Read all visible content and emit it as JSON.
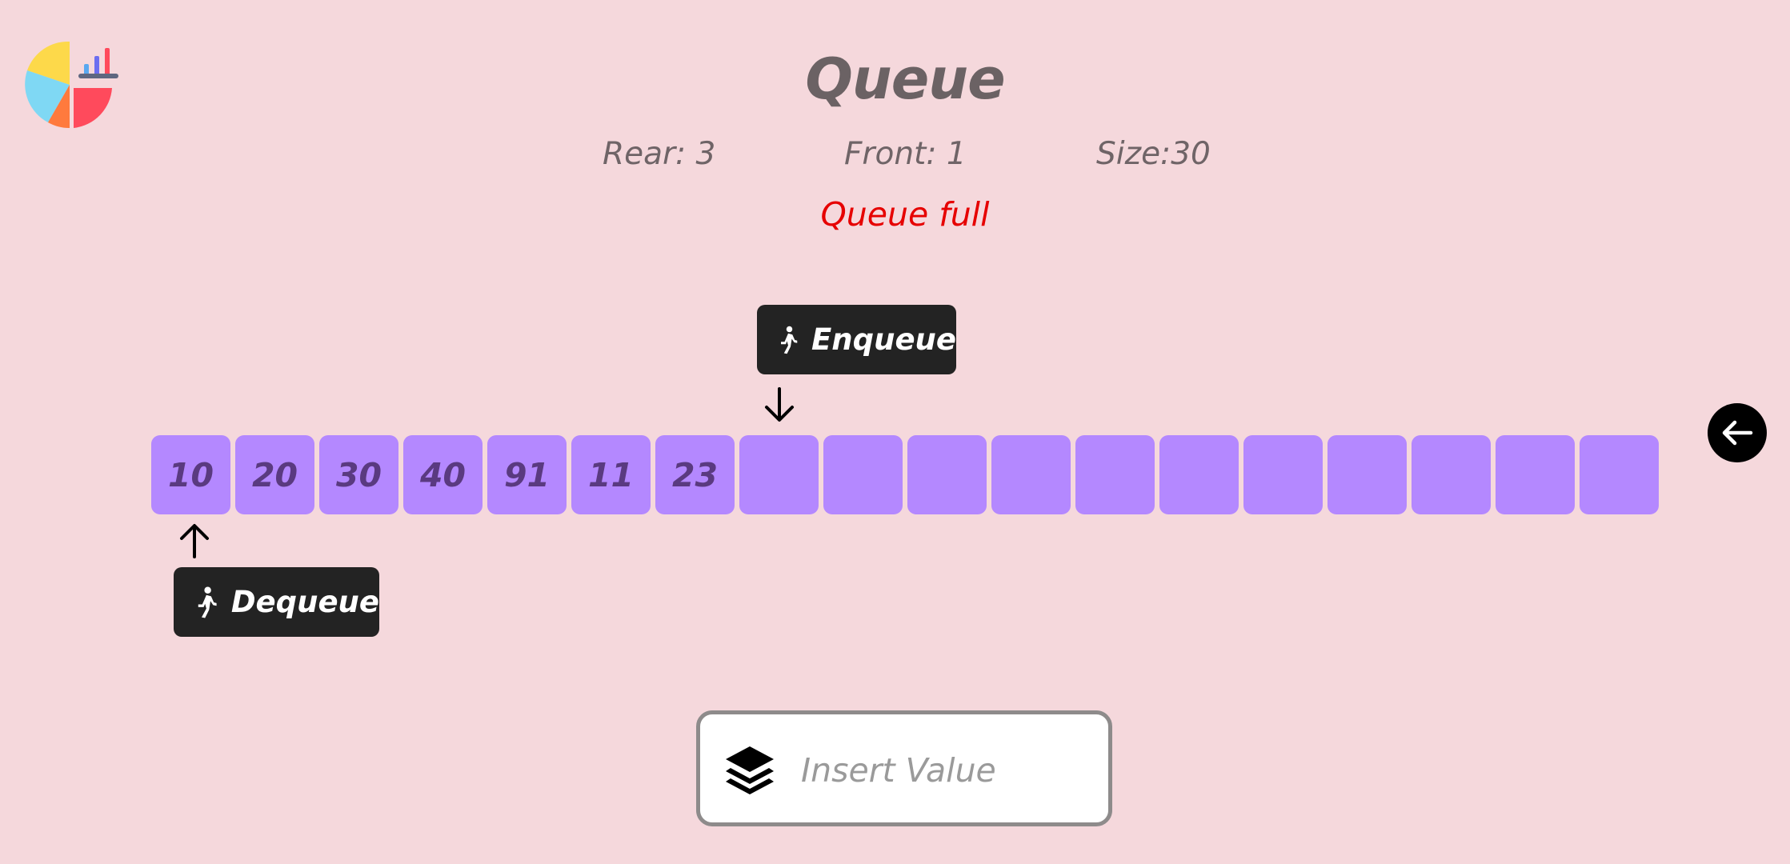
{
  "page": {
    "title": "Queue",
    "status_message": "Queue full",
    "colors": {
      "background": "#f5d8dc",
      "cell": "#b488ff",
      "cell_text": "#5a3a80",
      "status": "#e60000",
      "pill": "#232323"
    }
  },
  "stats": {
    "rear": "Rear: 3",
    "front": "Front: 1",
    "size": "Size:30"
  },
  "pointers": {
    "enqueue_label": "Enqueue",
    "dequeue_label": "Dequeue",
    "icon": "walking-person-icon"
  },
  "queue": {
    "cells": [
      "10",
      "20",
      "30",
      "40",
      "91",
      "11",
      "23",
      "",
      "",
      "",
      "",
      "",
      "",
      "",
      "",
      "",
      "",
      ""
    ]
  },
  "input": {
    "placeholder": "Insert Value",
    "value": "",
    "icon": "layers-icon"
  },
  "navigation": {
    "back_icon": "arrow-left-icon"
  },
  "logo": {
    "icon": "pie-chart-logo-icon"
  }
}
